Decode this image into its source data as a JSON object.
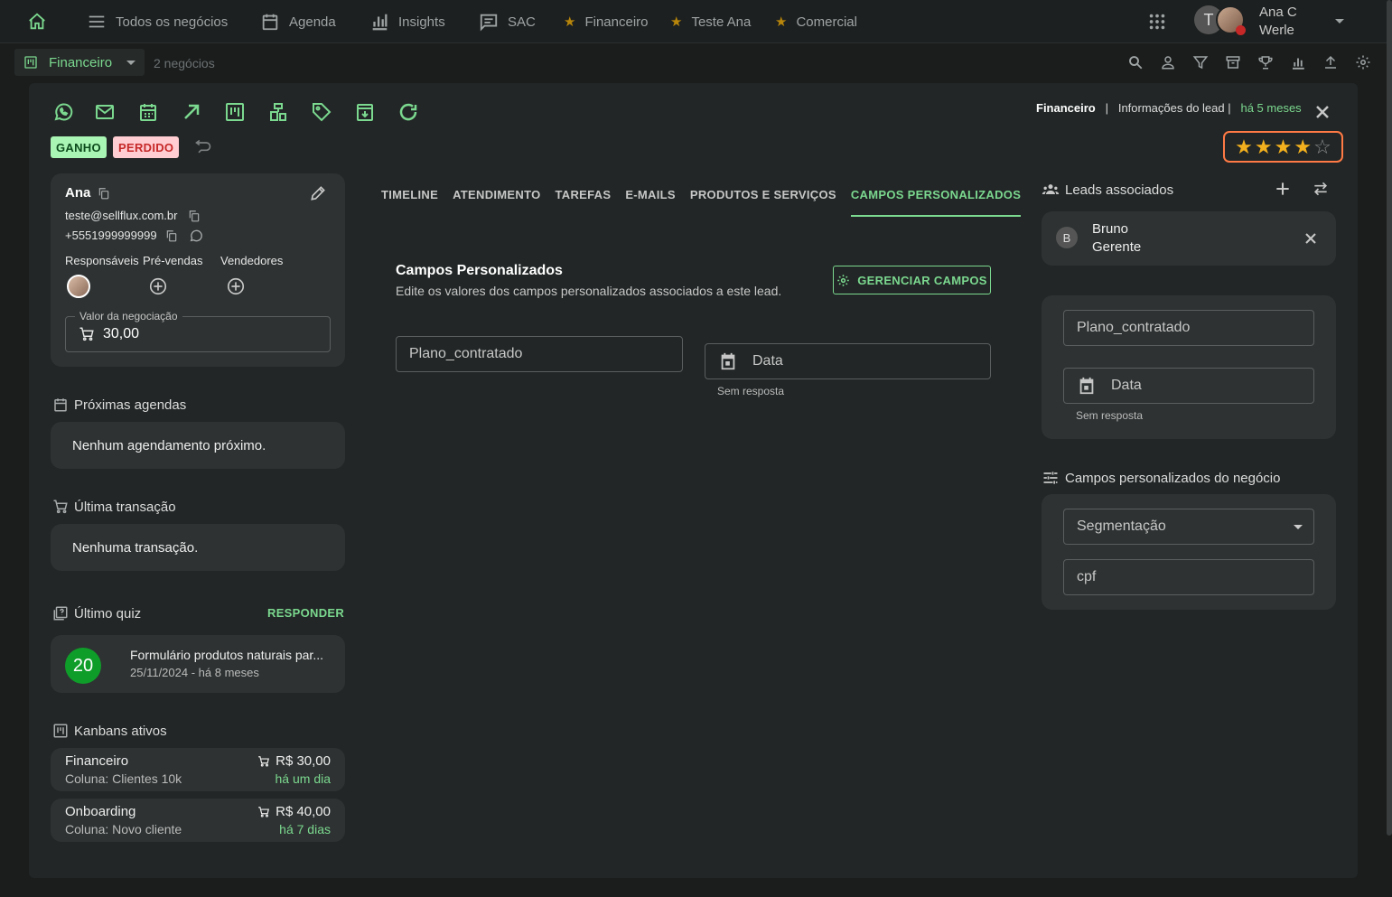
{
  "nav": {
    "items": [
      "Todos os negócios",
      "Agenda",
      "Insights",
      "SAC"
    ],
    "favorites": [
      "Financeiro",
      "Teste Ana",
      "Comercial"
    ],
    "user_initial": "T",
    "user_name_line1": "Ana C",
    "user_name_line2": "Werle"
  },
  "subbar": {
    "board": "Financeiro",
    "count": "2 negócios"
  },
  "modal": {
    "breadcrumb_board": "Financeiro",
    "breadcrumb_sep": "|",
    "breadcrumb_info": "Informações do lead |",
    "breadcrumb_time": "há 5 meses",
    "badge_won": "GANHO",
    "badge_lost": "PERDIDO",
    "rating": 4,
    "rating_max": 5
  },
  "lead": {
    "name": "Ana",
    "email": "teste@sellflux.com.br",
    "phone": "+5551999999999",
    "roles": [
      "Responsáveis",
      "Pré-vendas",
      "Vendedores"
    ],
    "value_label": "Valor da negociação",
    "value": "30,00"
  },
  "agenda": {
    "title": "Próximas agendas",
    "empty": "Nenhum agendamento próximo."
  },
  "transaction": {
    "title": "Última transação",
    "empty": "Nenhuma transação."
  },
  "quiz": {
    "title": "Último quiz",
    "action": "RESPONDER",
    "score": "20",
    "name": "Formulário produtos naturais par...",
    "date": "25/11/2024 - há 8 meses"
  },
  "kanbans": {
    "title": "Kanbans ativos",
    "items": [
      {
        "name": "Financeiro",
        "column": "Coluna: Clientes 10k",
        "value": "R$ 30,00",
        "time": "há um dia"
      },
      {
        "name": "Onboarding",
        "column": "Coluna: Novo cliente",
        "value": "R$ 40,00",
        "time": "há 7 dias"
      }
    ]
  },
  "tabs": [
    "TIMELINE",
    "ATENDIMENTO",
    "TAREFAS",
    "E-MAILS",
    "PRODUTOS E SERVIÇOS",
    "CAMPOS PERSONALIZADOS"
  ],
  "custom_fields": {
    "title": "Campos Personalizados",
    "subtitle": "Edite os valores dos campos personalizados associados a este lead.",
    "manage": "GERENCIAR CAMPOS",
    "field_plan": "Plano_contratado",
    "field_date": "Data",
    "no_answer": "Sem resposta"
  },
  "associated": {
    "title": "Leads associados",
    "lead_name": "Bruno",
    "lead_role": "Gerente",
    "lead_initial": "B"
  },
  "side_fields": {
    "plan": "Plano_contratado",
    "date": "Data",
    "no_answer": "Sem resposta"
  },
  "deal_fields": {
    "title": "Campos personalizados do negócio",
    "segment": "Segmentação",
    "cpf": "cpf"
  }
}
